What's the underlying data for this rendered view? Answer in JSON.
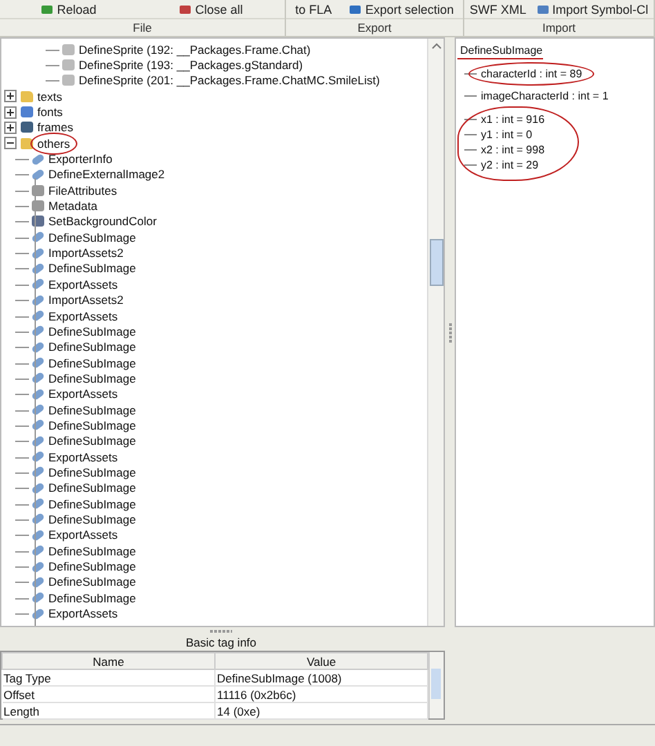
{
  "toolbar": {
    "groups": [
      {
        "label": "File",
        "buttons": [
          {
            "label": "Reload",
            "kind": "reload"
          },
          {
            "label": "Close all",
            "kind": "close"
          }
        ]
      },
      {
        "label": "Export",
        "buttons": [
          {
            "label": "to FLA",
            "kind": "plain"
          },
          {
            "label": "Export selection",
            "kind": "export"
          }
        ]
      },
      {
        "label": "Import",
        "buttons": [
          {
            "label": "SWF XML",
            "kind": "plain"
          },
          {
            "label": "Import Symbol-Cl",
            "kind": "import"
          }
        ]
      }
    ]
  },
  "tree": [
    {
      "label": "DefineSprite (192: __Packages.Frame.Chat)",
      "kind": "sprite"
    },
    {
      "label": "DefineSprite (193: __Packages.gStandard)",
      "kind": "sprite"
    },
    {
      "label": "DefineSprite (201: __Packages.Frame.ChatMC.SmileList)",
      "kind": "sprite"
    },
    {
      "label": "texts",
      "kind": "folder",
      "expanded": false
    },
    {
      "label": "fonts",
      "kind": "font",
      "expanded": false
    },
    {
      "label": "frames",
      "kind": "frames",
      "expanded": false
    },
    {
      "label": "others",
      "kind": "folder",
      "expanded": true,
      "children": [
        {
          "label": "ExporterInfo",
          "kind": "tag"
        },
        {
          "label": "DefineExternalImage2",
          "kind": "tag"
        },
        {
          "label": "FileAttributes",
          "kind": "file"
        },
        {
          "label": "Metadata",
          "kind": "file"
        },
        {
          "label": "SetBackgroundColor",
          "kind": "color"
        },
        {
          "label": "DefineSubImage",
          "kind": "tag"
        },
        {
          "label": "ImportAssets2",
          "kind": "tag"
        },
        {
          "label": "DefineSubImage",
          "kind": "tag"
        },
        {
          "label": "ExportAssets",
          "kind": "tag"
        },
        {
          "label": "ImportAssets2",
          "kind": "tag"
        },
        {
          "label": "ExportAssets",
          "kind": "tag"
        },
        {
          "label": "DefineSubImage",
          "kind": "tag"
        },
        {
          "label": "DefineSubImage",
          "kind": "tag"
        },
        {
          "label": "DefineSubImage",
          "kind": "tag"
        },
        {
          "label": "DefineSubImage",
          "kind": "tag"
        },
        {
          "label": "ExportAssets",
          "kind": "tag"
        },
        {
          "label": "DefineSubImage",
          "kind": "tag"
        },
        {
          "label": "DefineSubImage",
          "kind": "tag"
        },
        {
          "label": "DefineSubImage",
          "kind": "tag"
        },
        {
          "label": "ExportAssets",
          "kind": "tag"
        },
        {
          "label": "DefineSubImage",
          "kind": "tag"
        },
        {
          "label": "DefineSubImage",
          "kind": "tag"
        },
        {
          "label": "DefineSubImage",
          "kind": "tag"
        },
        {
          "label": "DefineSubImage",
          "kind": "tag"
        },
        {
          "label": "ExportAssets",
          "kind": "tag"
        },
        {
          "label": "DefineSubImage",
          "kind": "tag"
        },
        {
          "label": "DefineSubImage",
          "kind": "tag"
        },
        {
          "label": "DefineSubImage",
          "kind": "tag"
        },
        {
          "label": "DefineSubImage",
          "kind": "tag"
        },
        {
          "label": "ExportAssets",
          "kind": "tag"
        }
      ]
    }
  ],
  "details": {
    "root": "DefineSubImage",
    "fields": [
      "characterId : int = 89",
      "imageCharacterId : int = 1",
      "x1 : int = 916",
      "y1 : int = 0",
      "x2 : int = 998",
      "y2 : int = 29"
    ]
  },
  "tag_info": {
    "title": "Basic tag info",
    "columns": [
      "Name",
      "Value"
    ],
    "rows": [
      [
        "Tag Type",
        "DefineSubImage (1008)"
      ],
      [
        "Offset",
        "11116 (0x2b6c)"
      ],
      [
        "Length",
        "14 (0xe)"
      ]
    ]
  }
}
